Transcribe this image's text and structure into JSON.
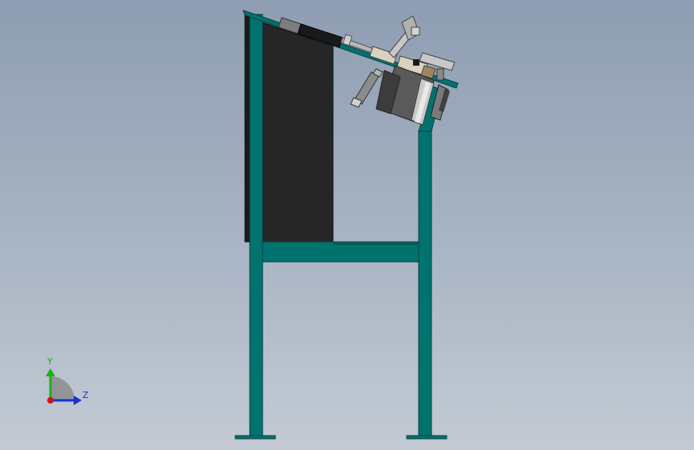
{
  "view": {
    "background_top": "#8e9db2",
    "background_bottom": "#c3cad4"
  },
  "model": {
    "frame_color": "#00736f",
    "frame_edge_color": "#0a3f3e",
    "panel_color": "#262626",
    "motor_color": "#5a5a5a"
  },
  "triad": {
    "y_label": "Y",
    "z_label": "Z",
    "y_color": "#19b219",
    "z_color": "#1a33cc",
    "x_color": "#cc1111"
  }
}
